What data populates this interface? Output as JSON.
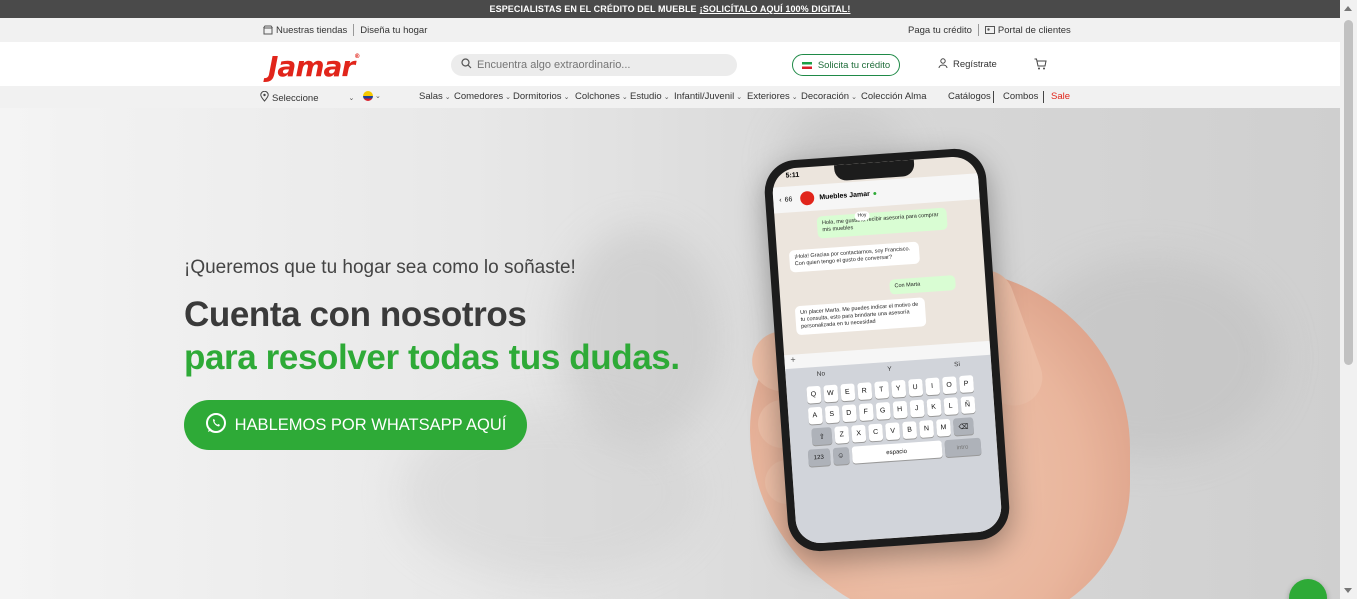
{
  "promo": {
    "text": "ESPECIALISTAS EN EL CRÉDITO DEL MUEBLE",
    "link": "¡SOLICÍTALO AQUÍ 100% DIGITAL!"
  },
  "utility": {
    "stores": "Nuestras tiendas",
    "design": "Diseña tu hogar",
    "pay_credit": "Paga tu crédito",
    "client_portal": "Portal de clientes"
  },
  "header": {
    "logo": "Jamar",
    "search_placeholder": "Encuentra algo extraordinario...",
    "credit_button": "Solicita tu crédito",
    "register": "Regístrate"
  },
  "nav": {
    "location": "Seleccione",
    "items": [
      "Salas",
      "Comedores",
      "Dormitorios",
      "Colchones",
      "Estudio",
      "Infantil/Juvenil",
      "Exteriores",
      "Decoración",
      "Colección Alma"
    ],
    "catalogs": "Catálogos",
    "combos": "Combos",
    "sale": "Sale"
  },
  "hero": {
    "subtitle": "¡Queremos que tu hogar sea como lo soñaste!",
    "title_line1": "Cuenta con nosotros",
    "title_line2": "para resolver todas tus dudas.",
    "cta": "HABLEMOS POR WHATSAPP AQUÍ"
  },
  "phone": {
    "time": "5:11",
    "back_count": "66",
    "contact": "Muebles Jamar",
    "day": "Hoy",
    "msg1": "Hola, me gustaría recibir asesoría para comprar mis muebles",
    "msg2": "¡Hola! Gracias por contactarnos, soy Francisco. Con quien tengo el gusto de conversar?",
    "msg3": "Con Marta",
    "msg4": "Un placer Marta. Me puedes indicar el motivo de tu consulta, esto para brindarte una asesoría personalizada en tu necesidad",
    "suggestions": [
      "No",
      "Y",
      "Si"
    ],
    "row1": [
      "Q",
      "W",
      "E",
      "R",
      "T",
      "Y",
      "U",
      "I",
      "O",
      "P"
    ],
    "row2": [
      "A",
      "S",
      "D",
      "F",
      "G",
      "H",
      "J",
      "K",
      "L",
      "Ñ"
    ],
    "row3": [
      "Z",
      "X",
      "C",
      "V",
      "B",
      "N",
      "M"
    ],
    "num_key": "123",
    "space_key": "espacio",
    "enter_key": "intro"
  },
  "colors": {
    "brand_red": "#e1251b",
    "brand_green": "#2eaa37"
  }
}
